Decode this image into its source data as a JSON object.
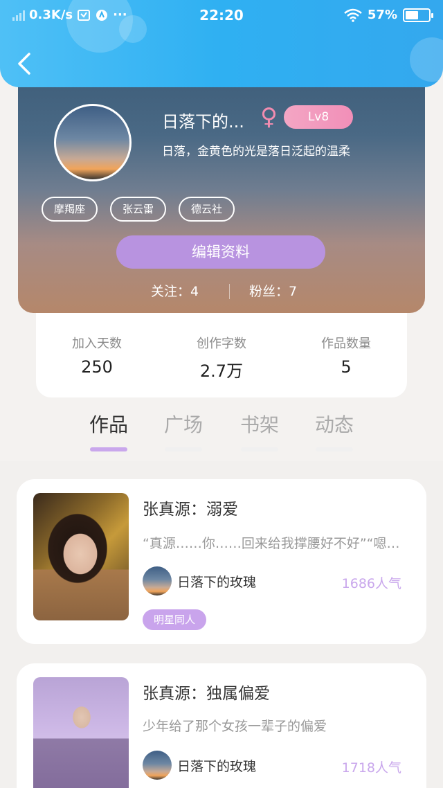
{
  "status_bar": {
    "network_speed": "0.3K/s",
    "time": "22:20",
    "battery_percent": "57%",
    "battery_level": 0.57
  },
  "profile": {
    "username": "日落下的...",
    "gender_symbol": "♀",
    "level": "Lv8",
    "bio": "日落，金黄色的光是落日泛起的温柔",
    "tags": [
      "摩羯座",
      "张云雷",
      "德云社"
    ],
    "edit_button": "编辑资料",
    "following": "关注：4",
    "followers": "粉丝：7"
  },
  "stats": [
    {
      "label": "加入天数",
      "value": "250"
    },
    {
      "label": "创作字数",
      "value": "2.7万"
    },
    {
      "label": "作品数量",
      "value": "5"
    }
  ],
  "tabs": [
    "作品",
    "广场",
    "书架",
    "动态"
  ],
  "works": [
    {
      "title": "张真源：溺爱",
      "desc": "“真源……你……回来给我撑腰好不好”“嗯…",
      "author": "日落下的玫瑰",
      "popularity": "1686人气",
      "badge": "明星同人"
    },
    {
      "title": "张真源：独属偏爱",
      "desc": "少年给了那个女孩一辈子的偏爱",
      "author": "日落下的玫瑰",
      "popularity": "1718人气"
    }
  ],
  "colors": {
    "header_blue": "#2fb0f2",
    "accent_purple": "#c9a7ec",
    "level_pink": "#f28fb8"
  }
}
